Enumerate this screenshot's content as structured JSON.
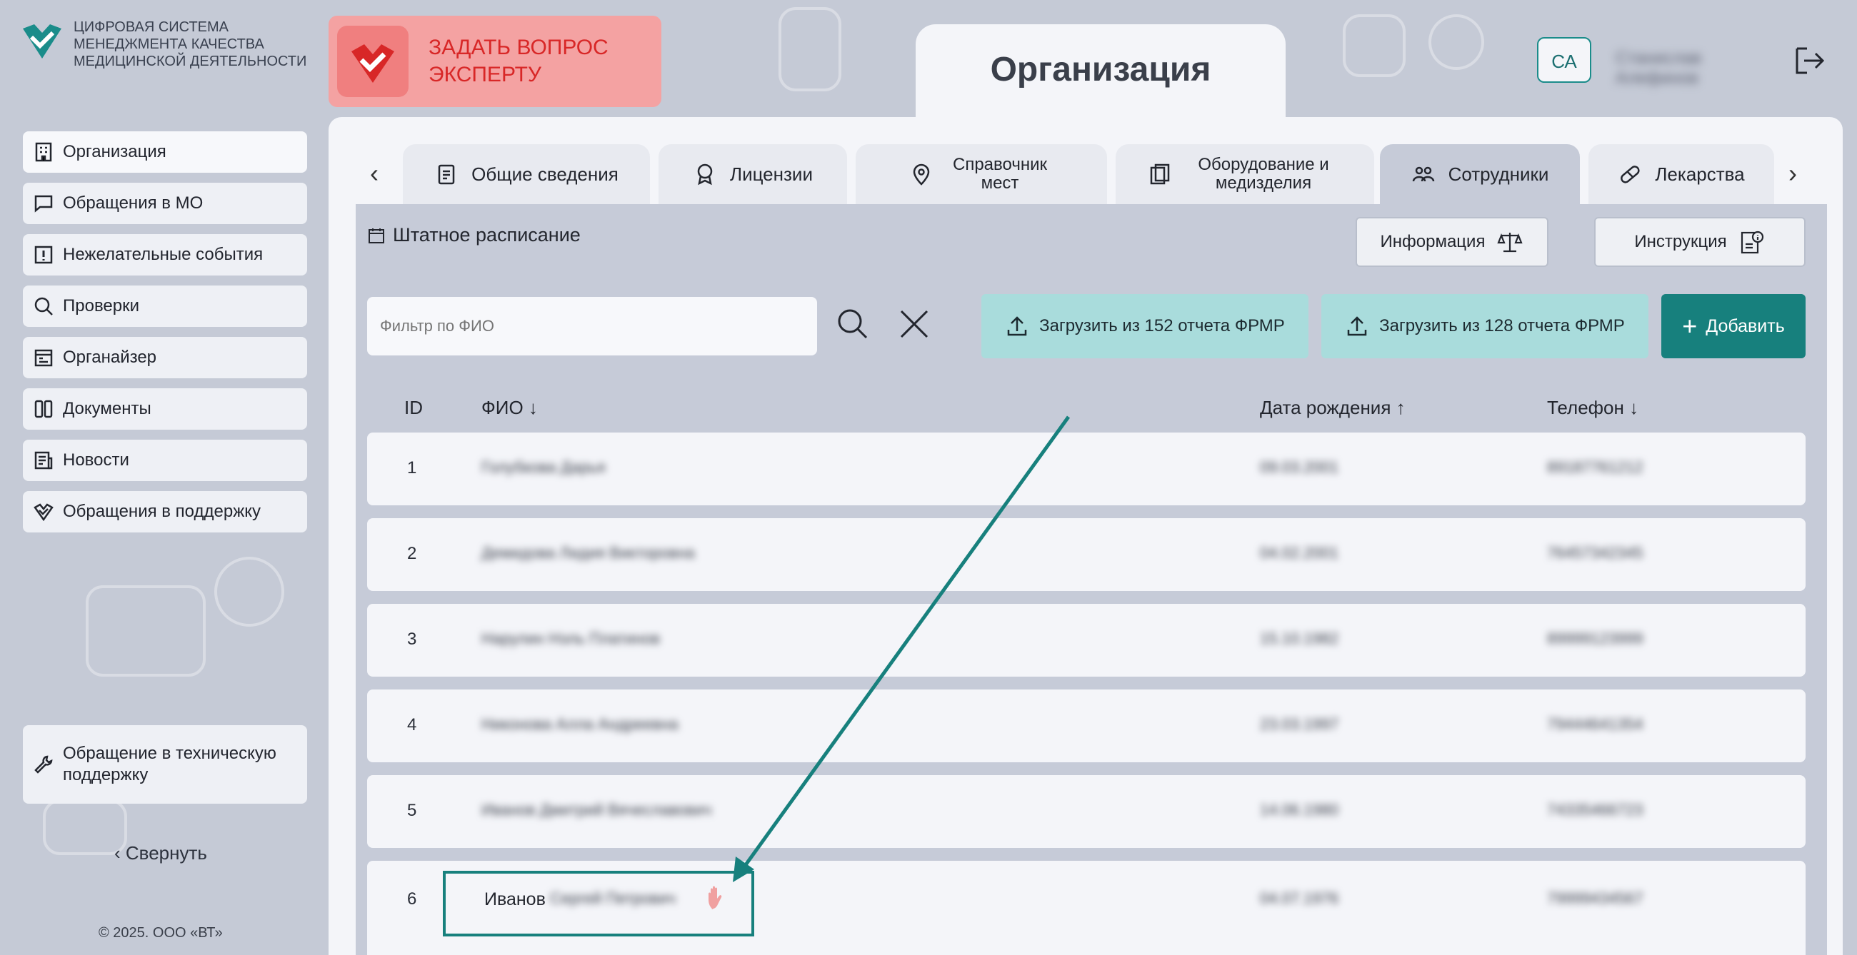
{
  "logo": {
    "text": "Цифровая система менеджмента качества медицинской деятельности"
  },
  "ask_expert": {
    "label": "ЗАДАТЬ ВОПРОС ЭКСПЕРТУ"
  },
  "page_tab": {
    "title": "Организация"
  },
  "user": {
    "initials": "СА",
    "name": "Станислав Алефинов"
  },
  "sidebar": {
    "items": [
      {
        "label": "Организация",
        "icon": "building-icon"
      },
      {
        "label": "Обращения в МО",
        "icon": "chat-icon"
      },
      {
        "label": "Нежелательные события",
        "icon": "alert-icon"
      },
      {
        "label": "Проверки",
        "icon": "search-icon"
      },
      {
        "label": "Органайзер",
        "icon": "calendar-icon"
      },
      {
        "label": "Документы",
        "icon": "documents-icon"
      },
      {
        "label": "Новости",
        "icon": "news-icon"
      },
      {
        "label": "Обращения в поддержку",
        "icon": "heart-check-icon"
      }
    ],
    "tech_support": "Обращение в техническую поддержку",
    "collapse": "Свернуть",
    "copyright": "© 2025. ООО «ВТ»"
  },
  "tabs": [
    {
      "label": "Общие сведения",
      "icon": "clipboard-icon"
    },
    {
      "label": "Лицензии",
      "icon": "award-icon"
    },
    {
      "label": "Справочник мест",
      "icon": "location-icon"
    },
    {
      "label": "Оборудование и медизделия",
      "icon": "equipment-icon"
    },
    {
      "label": "Сотрудники",
      "icon": "users-icon"
    },
    {
      "label": "Лекарства",
      "icon": "pill-icon"
    }
  ],
  "toolbar": {
    "schedule": "Штатное расписание",
    "info": "Информация",
    "instruction": "Инструкция",
    "filter_placeholder": "Фильтр по ФИО",
    "upload_152": "Загрузить из 152 отчета ФРМР",
    "upload_128": "Загрузить из 128 отчета ФРМР",
    "add": "Добавить"
  },
  "table": {
    "columns": [
      "ID",
      "ФИО ↓",
      "Дата рождения ↑",
      "Телефон ↓"
    ],
    "rows": [
      {
        "id": "1",
        "fio": "Голубкова Дарья",
        "dob": "09.03.2001",
        "phone": "89187761212"
      },
      {
        "id": "2",
        "fio": "Демидова Лидия Викторовна",
        "dob": "04.02.2001",
        "phone": "76457342345"
      },
      {
        "id": "3",
        "fio": "Нарулин Нэль Платинов",
        "dob": "15.10.1982",
        "phone": "89999123999"
      },
      {
        "id": "4",
        "fio": "Никонова Алла Андреевна",
        "dob": "23.03.1997",
        "phone": "79444641354"
      },
      {
        "id": "5",
        "fio": "Иванов Дмитрий Вячеславович",
        "dob": "14.06.1980",
        "phone": "74335466723"
      },
      {
        "id": "6",
        "fio_visible": "Иванов",
        "fio": "Сергей Петрович",
        "dob": "04.07.1976",
        "phone": "79999434567"
      }
    ]
  }
}
